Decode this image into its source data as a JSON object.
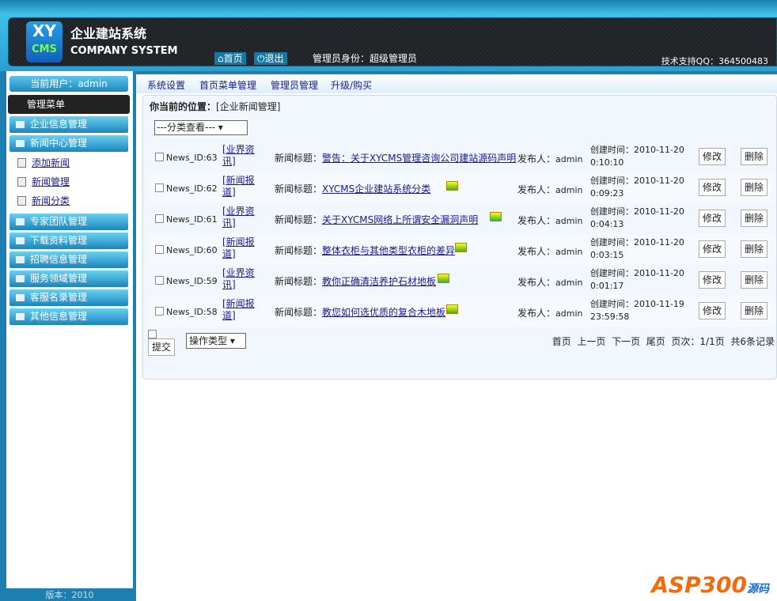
{
  "header": {
    "logo_top": "XY",
    "logo_bottom": "CMS",
    "brand_cn": "企业建站系统",
    "brand_en": "COMPANY SYSTEM",
    "home": "首页",
    "logout": "退出",
    "role": "管理员身份：超级管理员",
    "support": "技术支持QQ：364500483"
  },
  "sidebar": {
    "user": "当前用户：admin",
    "menu_title": "管理菜单",
    "groups": [
      "企业信息管理",
      "新闻中心管理",
      "专家团队管理",
      "下载资料管理",
      "招聘信息管理",
      "服务领域管理",
      "客服名录管理",
      "其他信息管理"
    ],
    "subitems": [
      "添加新闻",
      "新闻管理",
      "新闻分类"
    ],
    "version": "版本：2010"
  },
  "nav": [
    "系统设置",
    "首页菜单管理",
    "管理员管理",
    "升级/购买"
  ],
  "main": {
    "location_label": "你当前的位置：",
    "location": "[企业新闻管理]",
    "filter": "---分类查看---",
    "title_label": "新闻标题：",
    "publisher_label": "发布人：",
    "created_label": "创建时间：",
    "edit": "修改",
    "delete": "删除",
    "rows": [
      {
        "id": "News_ID:63",
        "cat1": "[业界资",
        "cat2": "讯]",
        "title": "警告：关于XYCMS管理咨询公司建站源码声明",
        "pub": "admin",
        "date": "2010-11-20",
        "time": "0:10:10",
        "img": false
      },
      {
        "id": "News_ID:62",
        "cat1": "[新闻报",
        "cat2": "道]",
        "title": "XYCMS企业建站系统分类",
        "pub": "admin",
        "date": "2010-11-20",
        "time": "0:09:23",
        "img": true
      },
      {
        "id": "News_ID:61",
        "cat1": "[业界资",
        "cat2": "讯]",
        "title": "关于XYCMS网络上所谓安全漏洞声明",
        "pub": "admin",
        "date": "2010-11-20",
        "time": "0:04:13",
        "img": true
      },
      {
        "id": "News_ID:60",
        "cat1": "[新闻报",
        "cat2": "道]",
        "title": "整体衣柜与其他类型衣柜的差异",
        "pub": "admin",
        "date": "2010-11-20",
        "time": "0:03:15",
        "img": true
      },
      {
        "id": "News_ID:59",
        "cat1": "[业界资",
        "cat2": "讯]",
        "title": "教你正确清洁养护石材地板",
        "pub": "admin",
        "date": "2010-11-20",
        "time": "0:01:17",
        "img": true
      },
      {
        "id": "News_ID:58",
        "cat1": "[新闻报",
        "cat2": "道]",
        "title": "教您如何选优质的复合木地板",
        "pub": "admin",
        "date": "2010-11-19",
        "time": "23:59:58",
        "img": true
      }
    ],
    "op_type": "操作类型",
    "submit": "提交",
    "pager": [
      "首页",
      "上一页",
      "下一页",
      "尾页"
    ],
    "pages": "页次：1/1页",
    "total": "共6条记录"
  },
  "watermark": {
    "main": "ASP300",
    "sub": "源码 .com"
  }
}
